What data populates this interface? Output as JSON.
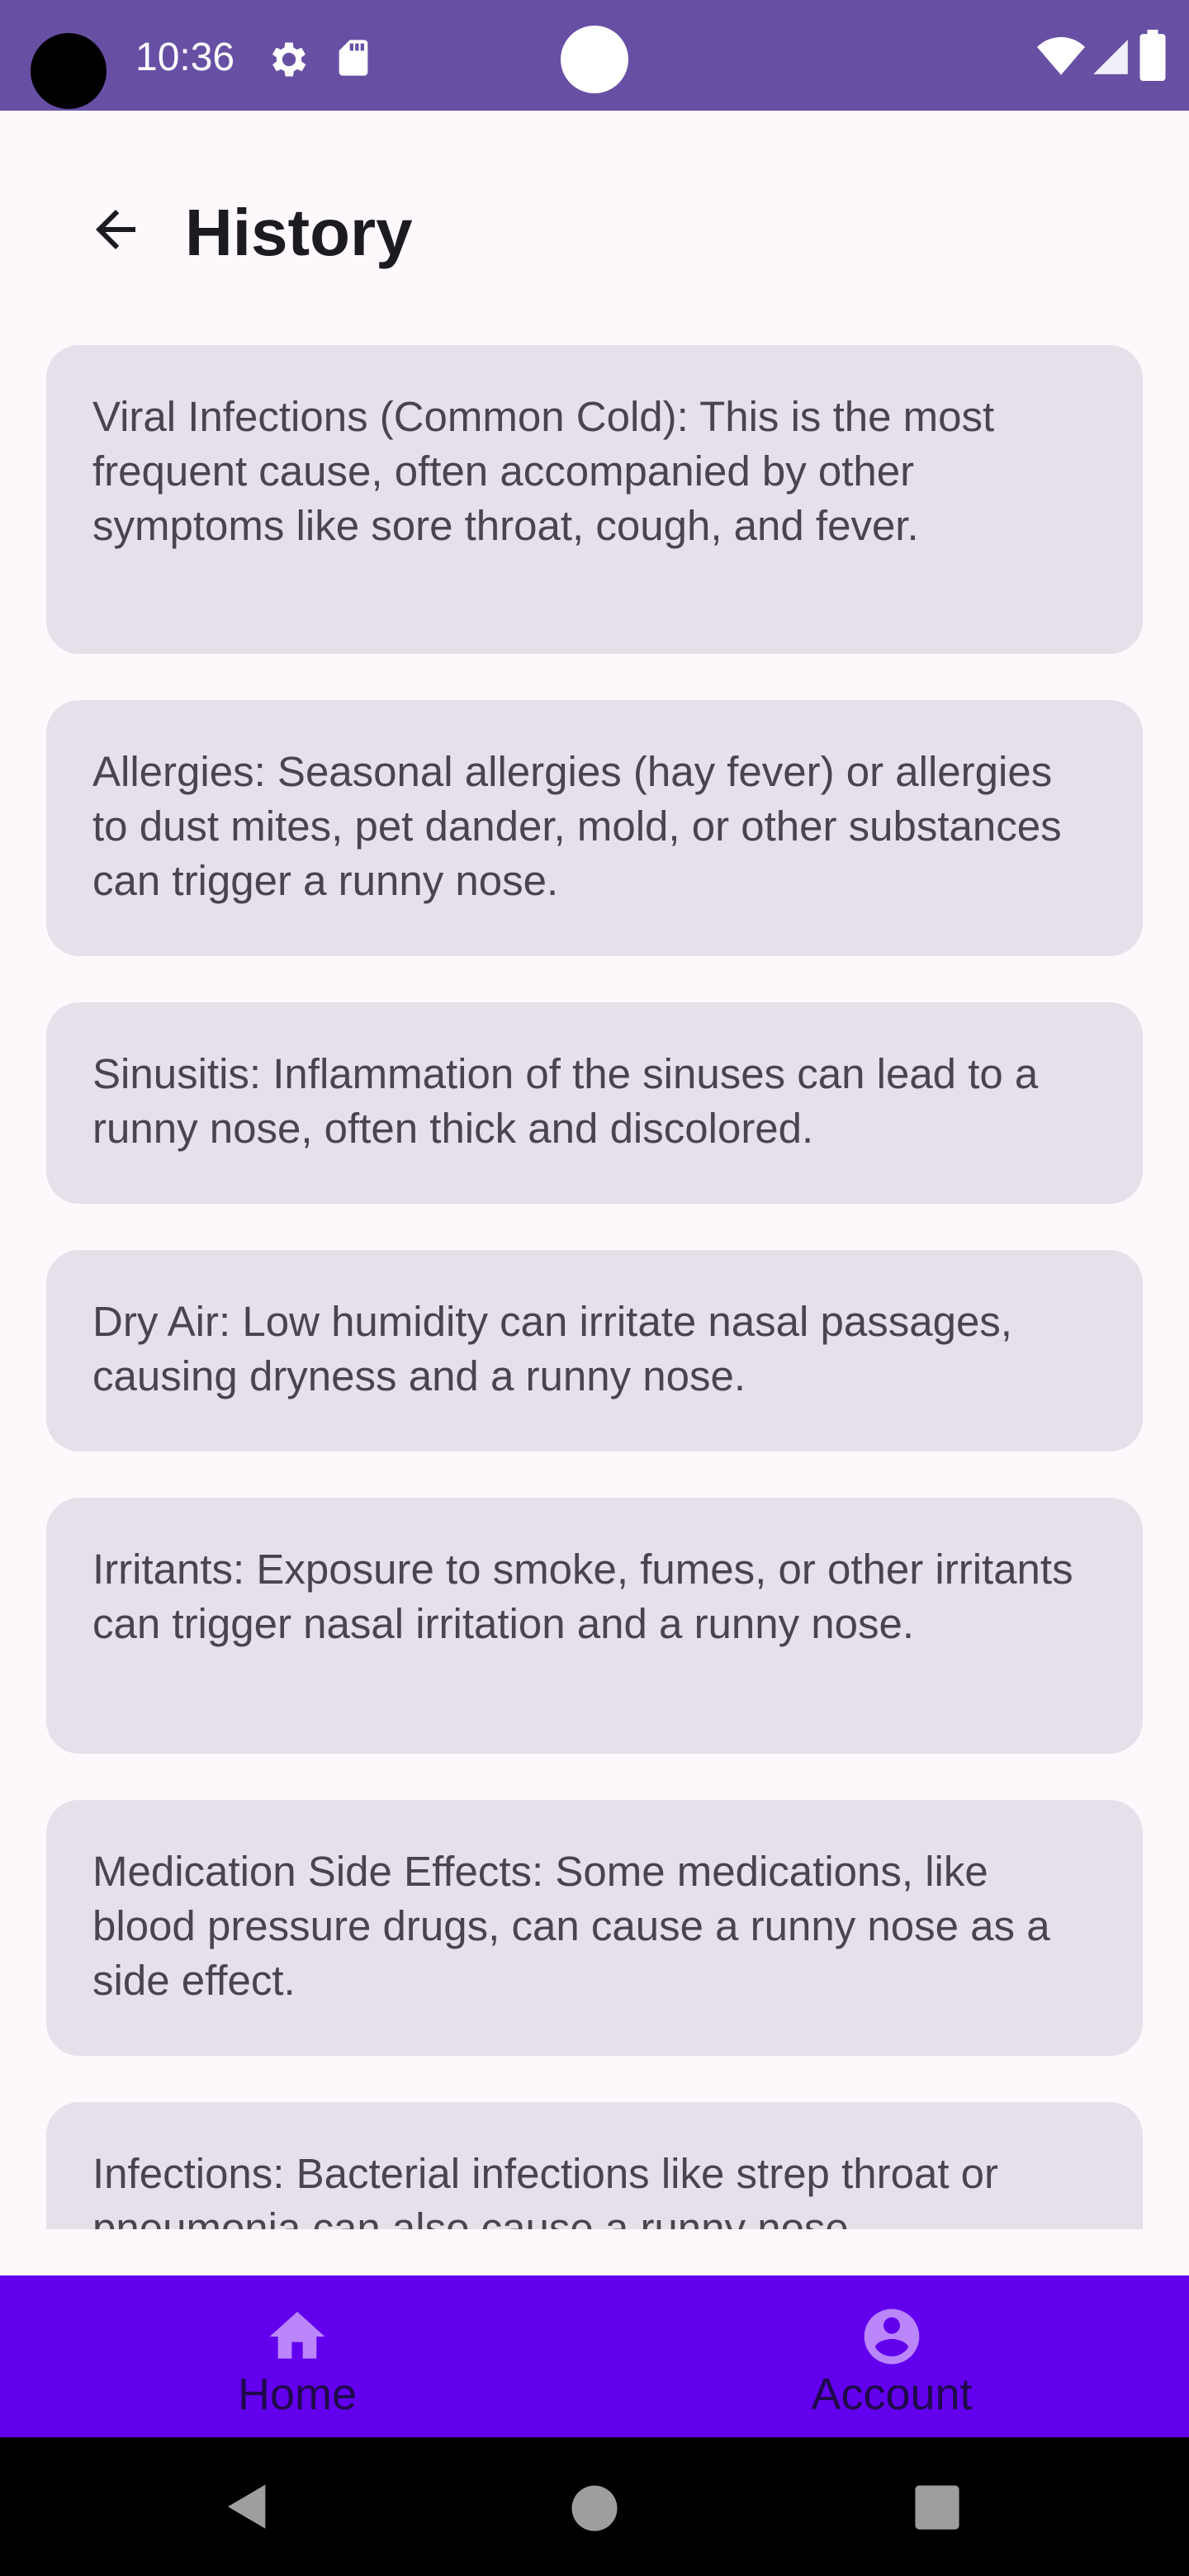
{
  "status_bar": {
    "time": "10:36",
    "icons": [
      "gear-icon",
      "sd-card-icon",
      "wifi-icon",
      "signal-icon",
      "battery-icon"
    ],
    "color": "#6750a4"
  },
  "app_bar": {
    "title": "History",
    "back_icon": "arrow-left-icon"
  },
  "cards": [
    " Viral Infections (Common Cold): This is the most frequent cause, often accompanied by other symptoms like sore throat, cough, and fever.",
    " Allergies: Seasonal allergies (hay fever) or allergies to dust mites, pet dander, mold, or other substances can trigger a runny nose.",
    " Sinusitis: Inflammation of the sinuses can lead to a runny nose, often thick and discolored.",
    " Dry Air:  Low humidity can irritate nasal passages, causing dryness and a runny nose.",
    " Irritants: Exposure to smoke, fumes, or other irritants can trigger nasal irritation and a runny nose.",
    " Medication Side Effects: Some medications, like blood pressure drugs, can cause a runny nose as a side effect.",
    " Infections: Bacterial infections like strep throat or pneumonia can also cause a runny nose."
  ],
  "bottom_nav": {
    "items": [
      {
        "label": "Home",
        "icon": "home-icon"
      },
      {
        "label": "Account",
        "icon": "account-circle-icon"
      }
    ],
    "background": "#6200ee",
    "icon_color": "#bb86fc"
  },
  "system_nav": {
    "buttons": [
      "back-triangle-icon",
      "home-circle-icon",
      "recents-square-icon"
    ]
  }
}
